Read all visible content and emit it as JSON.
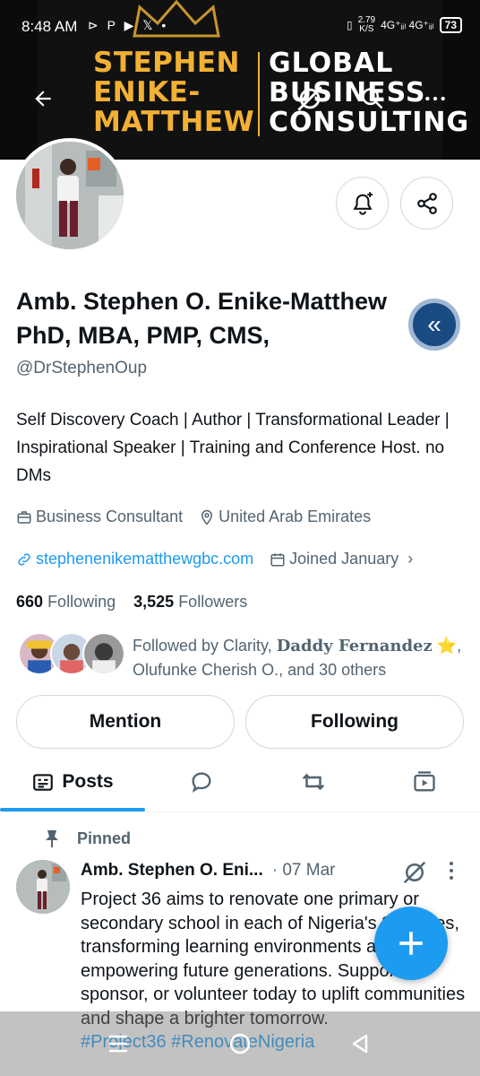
{
  "status": {
    "time": "8:48 AM",
    "app_icons": "⊳ P ▶ 𝕏 •",
    "speed_value": "2.79",
    "speed_unit": "K/S",
    "network": "4G⁺ᵢᵢₗ 4G⁺ᵢᵢₗ",
    "battery": "73"
  },
  "banner": {
    "left_line1": "STEPHEN",
    "left_line2": "ENIKE-",
    "left_line3": "MATTHEW",
    "right_line1": "GLOBAL",
    "right_line2": "BUSINESS",
    "right_line3": "CONSULTING"
  },
  "profile": {
    "name_line1": "Amb. Stephen O. Enike-Matthew",
    "name_line2": "PhD, MBA, PMP, CMS,",
    "handle": "@DrStephenOup",
    "bio": "Self Discovery Coach | Author | Transformational Leader | Inspirational Speaker | Training and Conference Host. no DMs",
    "profession": "Business Consultant",
    "location": "United Arab Emirates",
    "website": "stephenenikematthewgbc.com",
    "joined": "Joined January",
    "following_count": "660",
    "following_label": "Following",
    "followers_count": "3,525",
    "followers_label": "Followers",
    "followed_by_prefix": "Followed by Clarity,",
    "followed_by_fancy": "Daddy Fernandez",
    "followed_by_star": "⭐,",
    "followed_by_rest": "Olufunke Cherish O., and 30 others"
  },
  "actions": {
    "mention_label": "Mention",
    "following_label": "Following"
  },
  "tabs": {
    "posts_label": "Posts"
  },
  "post": {
    "pinned_label": "Pinned",
    "author": "Amb. Stephen O. Eni...",
    "date": "· 07 Mar",
    "body": "Project 36 aims to renovate one primary or secondary school in each of Nigeria's 36 states, transforming learning environments and empowering future generations. Support, sponsor, or volunteer today to uplift communities and shape a brighter tomorrow.",
    "hashtags": "#Project36 #RenovateNigeria"
  },
  "colors": {
    "accent": "#1d9bf0",
    "brand_gold": "#f2b134",
    "muted": "#536471"
  }
}
